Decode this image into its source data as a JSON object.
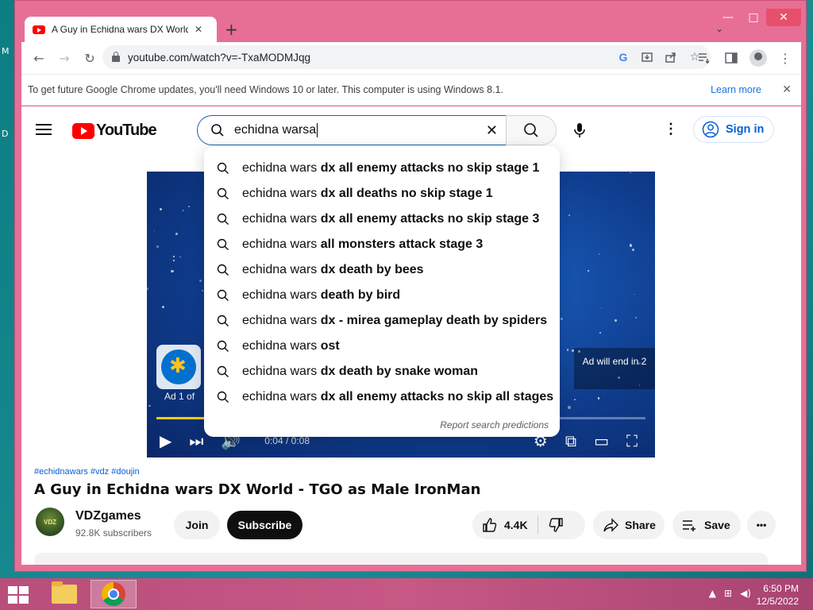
{
  "desktop": {
    "labels": [
      "M",
      "D"
    ]
  },
  "window": {
    "controls": {
      "minimize": "—",
      "maximize": "□",
      "close": "✕"
    }
  },
  "browser": {
    "tab": {
      "title": "A Guy in Echidna wars DX World",
      "close": "✕"
    },
    "new_tab": "+",
    "tab_search": "⌄",
    "nav": {
      "back": "←",
      "forward": "→",
      "reload": "↻"
    },
    "url": "youtube.com/watch?v=-TxaMODMJqg",
    "omni_icons": [
      "google-lens-icon",
      "install-app-icon",
      "share-icon",
      "bookmark-star-icon"
    ],
    "right_icons": [
      "reading-list-icon",
      "side-panel-icon",
      "profile-icon",
      "menu-icon"
    ]
  },
  "infobar": {
    "text": "To get future Google Chrome updates, you'll need Windows 10 or later. This computer is using Windows 8.1.",
    "learn_more": "Learn more",
    "close": "✕"
  },
  "youtube": {
    "logo_text": "YouTube",
    "search": {
      "value": "echidna warsa",
      "clear": "✕"
    },
    "more": "⋮",
    "signin": "Sign in",
    "suggestions": [
      {
        "prefix": "echidna wars ",
        "rest": "dx all enemy attacks no skip stage 1"
      },
      {
        "prefix": "echidna wars ",
        "rest": "dx all deaths no skip stage 1"
      },
      {
        "prefix": "echidna wars ",
        "rest": "dx all enemy attacks no skip stage 3"
      },
      {
        "prefix": "echidna wars ",
        "rest": "all monsters attack stage 3"
      },
      {
        "prefix": "echidna wars ",
        "rest": "dx death by bees"
      },
      {
        "prefix": "echidna wars ",
        "rest": "death by bird"
      },
      {
        "prefix": "echidna wars ",
        "rest": "dx - mirea gameplay death by spiders"
      },
      {
        "prefix": "echidna wars ",
        "rest": "ost"
      },
      {
        "prefix": "echidna wars ",
        "rest": "dx death by snake woman"
      },
      {
        "prefix": "echidna wars ",
        "rest": "dx all enemy attacks no skip all stages"
      }
    ],
    "report": "Report search predictions",
    "player": {
      "ad_index": "Ad 1 of",
      "ad_end": "Ad will end in 2",
      "time": "0:04 / 0:08",
      "progress": 0.5
    },
    "video": {
      "tags": "#echidnawars #vdz #doujin",
      "title": "A Guy in Echidna wars DX World - TGO as Male IronMan",
      "channel": "VDZgames",
      "channel_avatar_text": "VDZ",
      "subscribers": "92.8K subscribers",
      "join": "Join",
      "subscribe": "Subscribe",
      "likes": "4.4K",
      "share": "Share",
      "save": "Save",
      "more": "•••"
    }
  },
  "taskbar": {
    "time": "6:50 PM",
    "date": "12/5/2022",
    "tray": [
      "▲",
      "⊞",
      "◀)"
    ]
  }
}
